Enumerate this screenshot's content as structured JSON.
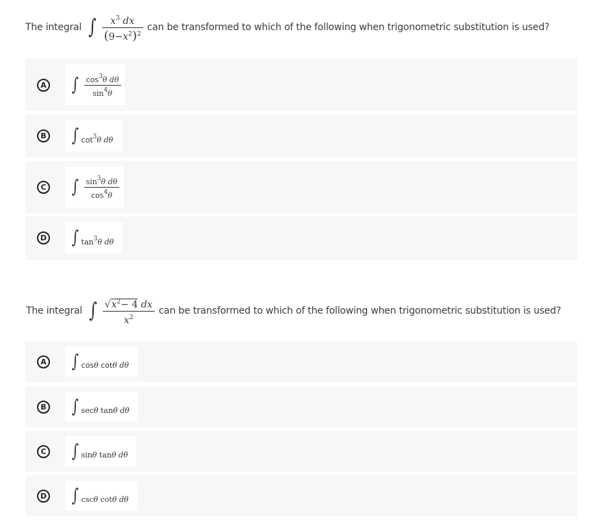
{
  "questions": [
    {
      "prefix": "The integral",
      "integrand": {
        "numerator": {
          "var": "x",
          "exp": "3",
          "diff": "dx"
        },
        "denominator": {
          "open": "(",
          "text": "9−",
          "var": "x",
          "exp": "2",
          "close": ")",
          "outer_exp": "2"
        }
      },
      "suffix": "can be transformed to which of the following when trigonometric substitution is used?",
      "options": [
        {
          "letter": "A",
          "kind": "fraction",
          "num_fn": "cos",
          "num_exp": "3",
          "num_var": "θ",
          "num_diff": "dθ",
          "den_fn": "sin",
          "den_exp": "4",
          "den_var": "θ"
        },
        {
          "letter": "B",
          "kind": "inline",
          "fn": "cot",
          "exp": "3",
          "var": "θ",
          "diff": "dθ"
        },
        {
          "letter": "C",
          "kind": "fraction",
          "num_fn": "sin",
          "num_exp": "3",
          "num_var": "θ",
          "num_diff": "dθ",
          "den_fn": "cos",
          "den_exp": "4",
          "den_var": "θ"
        },
        {
          "letter": "D",
          "kind": "inline",
          "fn": "tan",
          "exp": "3",
          "var": "θ",
          "diff": "dθ"
        }
      ]
    },
    {
      "prefix": "The integral",
      "integrand": {
        "numerator": {
          "sqrt_var": "x",
          "sqrt_exp": "2",
          "sqrt_rest": "− 4",
          "diff": "dx"
        },
        "denominator": {
          "var": "x",
          "exp": "2"
        }
      },
      "suffix": "can be transformed to which of the following when trigonometric substitution is used?",
      "options": [
        {
          "letter": "A",
          "kind": "product",
          "fn1": "cos",
          "fn2": "cot",
          "var": "θ",
          "diff": "dθ"
        },
        {
          "letter": "B",
          "kind": "product",
          "fn1": "sec",
          "fn2": "tan",
          "var": "θ",
          "diff": "dθ"
        },
        {
          "letter": "C",
          "kind": "product",
          "fn1": "sin",
          "fn2": "tan",
          "var": "θ",
          "diff": "dθ"
        },
        {
          "letter": "D",
          "kind": "product",
          "fn1": "csc",
          "fn2": "cot",
          "var": "θ",
          "diff": "dθ"
        }
      ]
    }
  ],
  "colors": {
    "option_background": "#f7f7f7",
    "formula_background": "#ffffff",
    "text": "#3b3b3b"
  }
}
